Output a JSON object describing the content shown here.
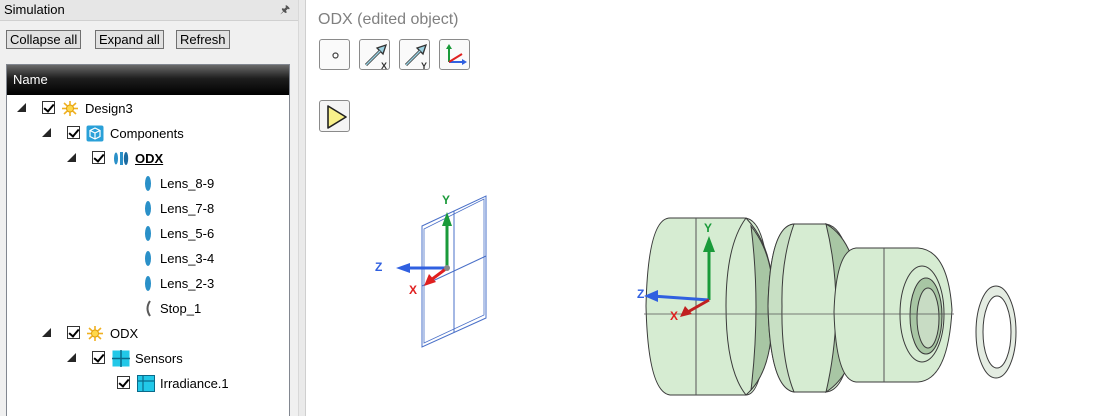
{
  "panel": {
    "title": "Simulation",
    "buttons": {
      "collapse": "Collapse all",
      "expand": "Expand all",
      "refresh": "Refresh"
    },
    "column_header": "Name"
  },
  "tree": {
    "design3": "Design3",
    "components": "Components",
    "odx_component": "ODX",
    "lenses": [
      "Lens_8-9",
      "Lens_7-8",
      "Lens_5-6",
      "Lens_3-4",
      "Lens_2-3"
    ],
    "stop": "Stop_1",
    "odx_simulation": "ODX",
    "sensors": "Sensors",
    "irradiance": "Irradiance.1"
  },
  "viewport": {
    "title": "ODX (edited object)",
    "axis_labels": {
      "sensor_y": "Y",
      "sensor_z": "Z",
      "sensor_x": "X",
      "system_y": "Y",
      "system_z": "Z",
      "system_x": "X"
    },
    "toolbar": {
      "x_sub": "X",
      "y_sub": "Y"
    }
  },
  "colors": {
    "lens_fill": "#d6ecd2",
    "lens_edge": "#3a3a3a",
    "axis_x": "#e02020",
    "axis_y": "#1a9a3a",
    "axis_z": "#3060e0",
    "sensor_frame": "#4a70c8"
  }
}
